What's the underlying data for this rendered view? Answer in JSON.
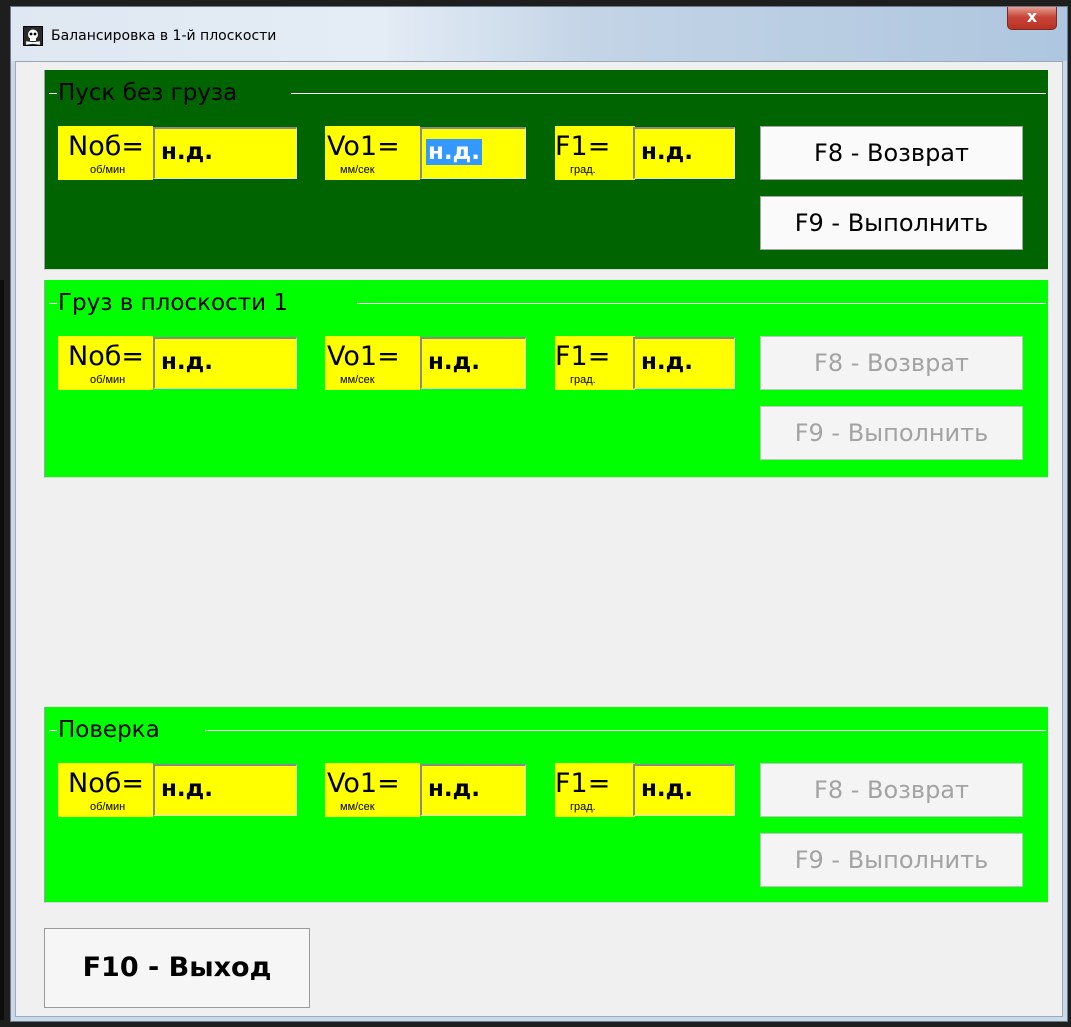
{
  "window": {
    "title": "Балансировка  в 1-й плоскости",
    "close_label": "x",
    "icon": "skull-app-icon"
  },
  "colors": {
    "panel1_bg": "#006400",
    "panel_bg": "#00ff00",
    "field_bg": "#ffff00",
    "selection": "#3399ff"
  },
  "panels": [
    {
      "title": "Пуск без груза",
      "fields": [
        {
          "label": "Nоб=",
          "unit": "об/мин",
          "value": "н.д."
        },
        {
          "label": "Vo1=",
          "unit": "мм/сек",
          "value": "н.д.",
          "selected": true
        },
        {
          "label": "F1=",
          "unit": "град.",
          "value": "н.д."
        }
      ],
      "back_label": "F8 - Возврат",
      "run_label": "F9 - Выполнить",
      "buttons_enabled": true
    },
    {
      "title": "Груз в плоскости 1",
      "fields": [
        {
          "label": "Nоб=",
          "unit": "об/мин",
          "value": "н.д."
        },
        {
          "label": "Vo1=",
          "unit": "мм/сек",
          "value": "н.д."
        },
        {
          "label": "F1=",
          "unit": "град.",
          "value": "н.д."
        }
      ],
      "back_label": "F8 - Возврат",
      "run_label": "F9 - Выполнить",
      "buttons_enabled": false
    },
    {
      "title": "Поверка",
      "fields": [
        {
          "label": "Nоб=",
          "unit": "об/мин",
          "value": "н.д."
        },
        {
          "label": "Vo1=",
          "unit": "мм/сек",
          "value": "н.д."
        },
        {
          "label": "F1=",
          "unit": "град.",
          "value": "н.д."
        }
      ],
      "back_label": "F8 - Возврат",
      "run_label": "F9 - Выполнить",
      "buttons_enabled": false
    }
  ],
  "exit_label": "F10 - Выход"
}
